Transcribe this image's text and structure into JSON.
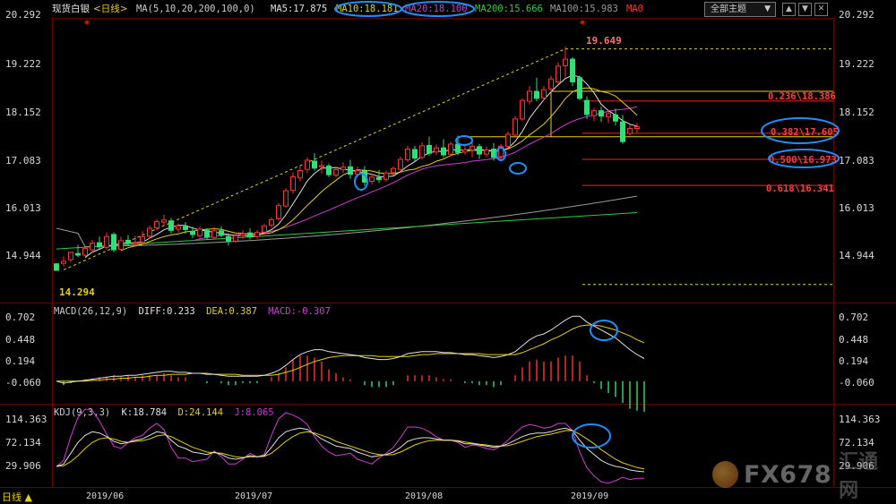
{
  "header": {
    "symbol": "现货白银",
    "period": "<日线>",
    "ma_def": "MA(5,10,20,200,100,0)",
    "ma5": "MA5:17.875",
    "ma10": "MA10:18.181",
    "ma20": "MA20:18.100",
    "ma200": "MA200:15.666",
    "ma100": "MA100:15.983",
    "ma0": "MA0",
    "menu": "全部主题",
    "menu_arrow": "▼",
    "btn_up": "▲",
    "btn_down": "▼",
    "btn_close": "✕"
  },
  "colors": {
    "up": "#ff3333",
    "down": "#33dd77",
    "ma5": "#e0e0e0",
    "ma10": "#e6d200",
    "ma20": "#d23cd2",
    "ma200": "#2ecc40",
    "ma100": "#9a9a9a",
    "fib": "#ff2020",
    "highlight": "#1e8fff"
  },
  "chart_data": [
    {
      "type": "candlestick",
      "panel": "price",
      "yticks": [
        "20.292",
        "19.222",
        "18.152",
        "17.083",
        "16.013",
        "14.944"
      ],
      "ylim": [
        13.5,
        20.4
      ],
      "x_labels": [
        "2019/06",
        "2019/07",
        "2019/08",
        "2019/09"
      ],
      "annotations": {
        "low": "14.294",
        "high": "19.649",
        "fib_236": "0.236\\18.386",
        "fib_382": "0.382\\17.605",
        "fib_500": "0.500\\16.973",
        "fib_618": "0.618\\16.341"
      },
      "moving_averages": [
        "MA5",
        "MA10",
        "MA20",
        "MA200",
        "MA100"
      ],
      "candles": [
        [
          14.44,
          14.45,
          14.28,
          14.27
        ],
        [
          14.45,
          14.62,
          14.5,
          14.38
        ],
        [
          14.54,
          14.7,
          14.72,
          14.48
        ],
        [
          14.69,
          14.9,
          14.65,
          14.6
        ],
        [
          14.65,
          14.85,
          14.81,
          14.6
        ],
        [
          14.78,
          15.02,
          14.94,
          14.72
        ],
        [
          14.95,
          15.1,
          14.85,
          14.8
        ],
        [
          14.84,
          15.2,
          15.1,
          14.78
        ],
        [
          15.15,
          15.2,
          14.78,
          14.72
        ],
        [
          14.79,
          15.1,
          15.0,
          14.75
        ],
        [
          15.01,
          15.14,
          14.95,
          14.88
        ],
        [
          14.93,
          15.12,
          14.96,
          14.85
        ],
        [
          14.97,
          15.23,
          15.1,
          14.91
        ],
        [
          15.11,
          15.37,
          15.3,
          15.05
        ],
        [
          15.31,
          15.52,
          15.46,
          15.26
        ],
        [
          15.45,
          15.63,
          15.5,
          15.36
        ],
        [
          15.48,
          15.55,
          15.25,
          15.18
        ],
        [
          15.28,
          15.42,
          15.36,
          15.2
        ],
        [
          15.34,
          15.45,
          15.27,
          15.17
        ],
        [
          15.23,
          15.34,
          15.15,
          15.06
        ],
        [
          15.12,
          15.35,
          15.28,
          15.07
        ],
        [
          15.25,
          15.3,
          15.09,
          15.02
        ],
        [
          15.08,
          15.33,
          15.24,
          15.04
        ],
        [
          15.24,
          15.35,
          15.14,
          15.08
        ],
        [
          15.1,
          15.18,
          14.99,
          14.88
        ],
        [
          14.99,
          15.2,
          15.12,
          14.95
        ],
        [
          15.13,
          15.25,
          15.17,
          15.05
        ],
        [
          15.19,
          15.3,
          15.1,
          15.03
        ],
        [
          15.1,
          15.26,
          15.2,
          15.05
        ],
        [
          15.21,
          15.4,
          15.36,
          15.18
        ],
        [
          15.38,
          15.56,
          15.51,
          15.32
        ],
        [
          15.53,
          15.91,
          15.85,
          15.49
        ],
        [
          15.84,
          16.27,
          16.21,
          15.8
        ],
        [
          16.22,
          16.66,
          16.55,
          16.14
        ],
        [
          16.52,
          16.8,
          16.7,
          16.44
        ],
        [
          16.73,
          17.02,
          16.95,
          16.64
        ],
        [
          16.93,
          17.12,
          16.76,
          16.7
        ],
        [
          16.79,
          16.94,
          16.82,
          16.63
        ],
        [
          16.81,
          16.87,
          16.6,
          16.54
        ],
        [
          16.59,
          16.8,
          16.72,
          16.53
        ],
        [
          16.72,
          16.9,
          16.78,
          16.64
        ],
        [
          16.79,
          16.96,
          16.61,
          16.5
        ],
        [
          16.61,
          16.79,
          16.7,
          16.54
        ],
        [
          16.69,
          16.81,
          16.42,
          16.33
        ],
        [
          16.44,
          16.62,
          16.54,
          16.37
        ],
        [
          16.53,
          16.71,
          16.48,
          16.4
        ],
        [
          16.49,
          16.7,
          16.64,
          16.42
        ],
        [
          16.65,
          16.8,
          16.75,
          16.58
        ],
        [
          16.73,
          17.04,
          16.97,
          16.66
        ],
        [
          16.96,
          17.3,
          17.22,
          16.91
        ],
        [
          17.21,
          17.3,
          17.0,
          16.92
        ],
        [
          17.02,
          17.38,
          17.3,
          16.97
        ],
        [
          17.31,
          17.52,
          17.12,
          17.06
        ],
        [
          17.15,
          17.33,
          17.25,
          17.08
        ],
        [
          17.25,
          17.46,
          17.08,
          17.02
        ],
        [
          17.1,
          17.4,
          17.34,
          17.06
        ],
        [
          17.34,
          17.55,
          17.14,
          17.07
        ],
        [
          17.15,
          17.35,
          17.2,
          17.09
        ],
        [
          17.2,
          17.5,
          17.29,
          17.02
        ],
        [
          17.28,
          17.35,
          17.1,
          16.98
        ],
        [
          17.1,
          17.28,
          17.2,
          17.02
        ],
        [
          17.22,
          17.37,
          17.02,
          16.94
        ],
        [
          17.04,
          17.35,
          17.29,
          16.95
        ],
        [
          17.29,
          17.65,
          17.58,
          17.23
        ],
        [
          17.56,
          18.02,
          17.95,
          17.49
        ],
        [
          17.95,
          18.45,
          18.4,
          17.9
        ],
        [
          18.38,
          18.75,
          18.62,
          18.3
        ],
        [
          18.62,
          18.95,
          18.45,
          18.38
        ],
        [
          18.46,
          18.75,
          18.66,
          18.4
        ],
        [
          18.68,
          19.0,
          18.92,
          18.6
        ],
        [
          18.85,
          19.32,
          19.23,
          18.8
        ],
        [
          19.24,
          19.7,
          19.4,
          18.96
        ],
        [
          19.4,
          19.45,
          18.85,
          18.75
        ],
        [
          18.95,
          19.0,
          18.45,
          18.4
        ],
        [
          18.4,
          18.5,
          18.06,
          17.95
        ],
        [
          18.03,
          18.22,
          18.15,
          17.9
        ],
        [
          18.15,
          18.25,
          18.02,
          17.88
        ],
        [
          18.0,
          18.18,
          18.08,
          17.85
        ],
        [
          18.05,
          18.2,
          17.9,
          17.8
        ],
        [
          17.88,
          18.05,
          17.4,
          17.35
        ],
        [
          17.6,
          17.82,
          17.72,
          17.55
        ],
        [
          17.72,
          17.85,
          17.76,
          17.62
        ]
      ]
    },
    {
      "type": "bar+line",
      "panel": "MACD",
      "title": "MACD(26,12,9)",
      "diff": "DIFF:0.233",
      "dea": "DEA:0.387",
      "macd": "MACD:-0.307",
      "yticks": [
        "0.702",
        "0.448",
        "0.194",
        "-0.060"
      ],
      "ylim": [
        -0.22,
        0.78
      ],
      "diff_values": [
        0.0,
        -0.02,
        -0.01,
        0.0,
        0.01,
        0.02,
        0.03,
        0.04,
        0.05,
        0.05,
        0.06,
        0.06,
        0.07,
        0.08,
        0.09,
        0.1,
        0.1,
        0.09,
        0.09,
        0.08,
        0.08,
        0.07,
        0.07,
        0.06,
        0.05,
        0.05,
        0.05,
        0.05,
        0.05,
        0.06,
        0.08,
        0.11,
        0.16,
        0.22,
        0.27,
        0.3,
        0.32,
        0.32,
        0.3,
        0.29,
        0.28,
        0.27,
        0.26,
        0.24,
        0.23,
        0.22,
        0.22,
        0.23,
        0.25,
        0.28,
        0.29,
        0.3,
        0.3,
        0.3,
        0.29,
        0.29,
        0.28,
        0.27,
        0.27,
        0.26,
        0.25,
        0.24,
        0.25,
        0.27,
        0.3,
        0.36,
        0.42,
        0.46,
        0.48,
        0.52,
        0.57,
        0.62,
        0.66,
        0.66,
        0.6,
        0.56,
        0.52,
        0.48,
        0.44,
        0.38,
        0.32,
        0.27,
        0.23
      ],
      "dea_values": [
        0.0,
        0.0,
        0.0,
        0.0,
        0.0,
        0.01,
        0.01,
        0.02,
        0.02,
        0.03,
        0.03,
        0.04,
        0.04,
        0.05,
        0.06,
        0.06,
        0.07,
        0.07,
        0.07,
        0.08,
        0.08,
        0.08,
        0.07,
        0.07,
        0.07,
        0.07,
        0.06,
        0.06,
        0.06,
        0.06,
        0.06,
        0.07,
        0.09,
        0.11,
        0.14,
        0.17,
        0.2,
        0.22,
        0.24,
        0.25,
        0.26,
        0.26,
        0.26,
        0.26,
        0.26,
        0.25,
        0.25,
        0.25,
        0.25,
        0.25,
        0.26,
        0.27,
        0.27,
        0.28,
        0.28,
        0.28,
        0.28,
        0.28,
        0.28,
        0.28,
        0.27,
        0.27,
        0.27,
        0.27,
        0.27,
        0.29,
        0.32,
        0.35,
        0.38,
        0.42,
        0.45,
        0.49,
        0.53,
        0.56,
        0.57,
        0.57,
        0.56,
        0.54,
        0.52,
        0.49,
        0.46,
        0.42,
        0.39
      ],
      "macd_values": [
        0.0,
        -0.04,
        -0.02,
        0.0,
        0.02,
        0.02,
        0.04,
        0.04,
        0.06,
        0.04,
        0.06,
        0.04,
        0.06,
        0.06,
        0.06,
        0.08,
        0.06,
        0.04,
        0.04,
        0.0,
        0.0,
        -0.02,
        0.0,
        -0.02,
        -0.04,
        -0.04,
        -0.02,
        -0.02,
        -0.02,
        0.0,
        0.04,
        0.08,
        0.14,
        0.22,
        0.26,
        0.26,
        0.24,
        0.2,
        0.12,
        0.08,
        0.04,
        0.02,
        0.0,
        -0.04,
        -0.06,
        -0.06,
        -0.06,
        -0.04,
        0.0,
        0.06,
        0.06,
        0.06,
        0.06,
        0.04,
        0.02,
        0.02,
        0.0,
        -0.02,
        -0.02,
        -0.04,
        -0.04,
        -0.06,
        -0.04,
        0.0,
        0.06,
        0.14,
        0.2,
        0.22,
        0.2,
        0.2,
        0.24,
        0.26,
        0.26,
        0.2,
        0.06,
        -0.02,
        -0.08,
        -0.12,
        -0.16,
        -0.22,
        -0.28,
        -0.3,
        -0.31
      ]
    },
    {
      "type": "line",
      "panel": "KDJ",
      "title": "KDJ(9,3,3)",
      "k": "K:18.784",
      "d": "D:24.144",
      "j": "J:8.065",
      "yticks": [
        "114.363",
        "72.134",
        "29.906"
      ],
      "ylim": [
        -5,
        130
      ],
      "k_values": [
        28,
        32,
        50,
        68,
        80,
        86,
        84,
        78,
        70,
        66,
        68,
        72,
        74,
        80,
        86,
        84,
        72,
        62,
        58,
        52,
        50,
        48,
        52,
        48,
        42,
        40,
        42,
        46,
        44,
        46,
        60,
        76,
        86,
        90,
        92,
        90,
        82,
        74,
        68,
        62,
        60,
        58,
        52,
        48,
        44,
        46,
        48,
        52,
        60,
        70,
        74,
        76,
        76,
        74,
        72,
        72,
        70,
        66,
        66,
        64,
        62,
        60,
        62,
        66,
        72,
        78,
        82,
        84,
        84,
        86,
        90,
        92,
        88,
        72,
        58,
        48,
        38,
        32,
        28,
        26,
        22,
        20,
        19
      ],
      "d_values": [
        28,
        29,
        36,
        46,
        58,
        68,
        74,
        76,
        74,
        70,
        68,
        70,
        71,
        74,
        79,
        81,
        78,
        72,
        66,
        60,
        56,
        52,
        51,
        50,
        47,
        44,
        43,
        44,
        44,
        45,
        50,
        60,
        70,
        78,
        84,
        86,
        84,
        80,
        76,
        70,
        66,
        62,
        58,
        54,
        50,
        48,
        47,
        48,
        52,
        58,
        64,
        68,
        71,
        72,
        72,
        72,
        71,
        69,
        67,
        65,
        64,
        62,
        62,
        63,
        66,
        70,
        74,
        78,
        80,
        82,
        85,
        88,
        88,
        82,
        74,
        66,
        56,
        48,
        40,
        34,
        30,
        26,
        24
      ],
      "j_values": [
        28,
        38,
        78,
        110,
        124,
        122,
        104,
        82,
        62,
        58,
        68,
        76,
        80,
        92,
        100,
        90,
        60,
        42,
        42,
        36,
        38,
        40,
        54,
        44,
        32,
        32,
        40,
        50,
        44,
        48,
        80,
        108,
        118,
        114,
        108,
        98,
        78,
        62,
        52,
        46,
        48,
        50,
        40,
        36,
        32,
        42,
        50,
        60,
        76,
        94,
        94,
        92,
        86,
        78,
        72,
        72,
        68,
        60,
        64,
        62,
        58,
        56,
        62,
        72,
        84,
        94,
        98,
        96,
        92,
        94,
        100,
        100,
        88,
        52,
        26,
        12,
        2,
        0,
        4,
        10,
        6,
        8,
        8
      ]
    }
  ]
}
